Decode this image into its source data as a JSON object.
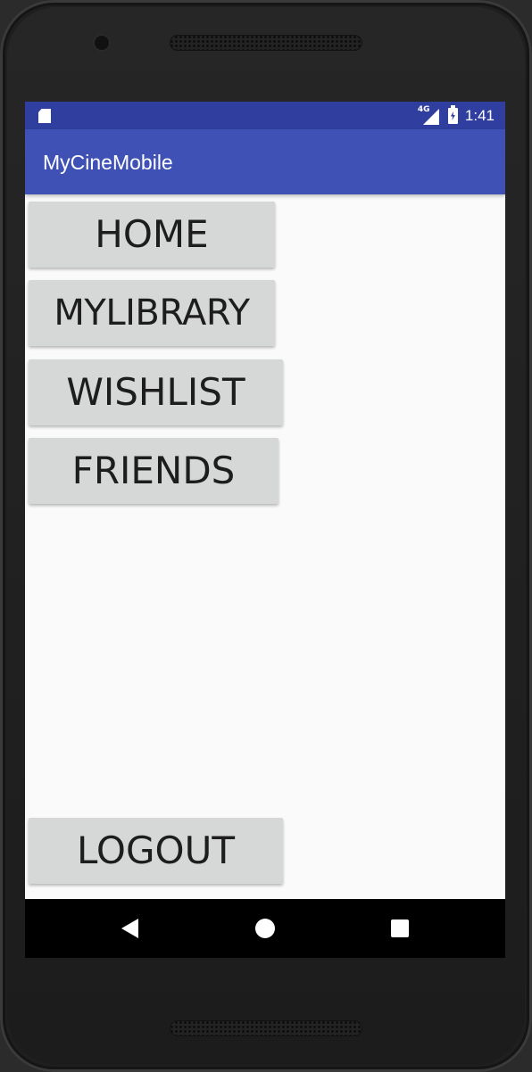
{
  "status_bar": {
    "time": "1:41",
    "network_label": "4G",
    "icons": [
      "sd-card-icon",
      "signal-icon",
      "battery-icon"
    ],
    "color": "#303f9f"
  },
  "app_bar": {
    "title": "MyCineMobile",
    "color": "#3f51b5"
  },
  "menu": {
    "home": "HOME",
    "mylibrary": "MYLIBRARY",
    "wishlist": "WISHLIST",
    "friends": "FRIENDS"
  },
  "footer": {
    "logout": "LOGOUT"
  },
  "nav_bar": {
    "icons": [
      "back-icon",
      "home-icon",
      "recents-icon"
    ]
  },
  "colors": {
    "button_bg": "#d6d7d7",
    "screen_bg": "#fafafa"
  }
}
